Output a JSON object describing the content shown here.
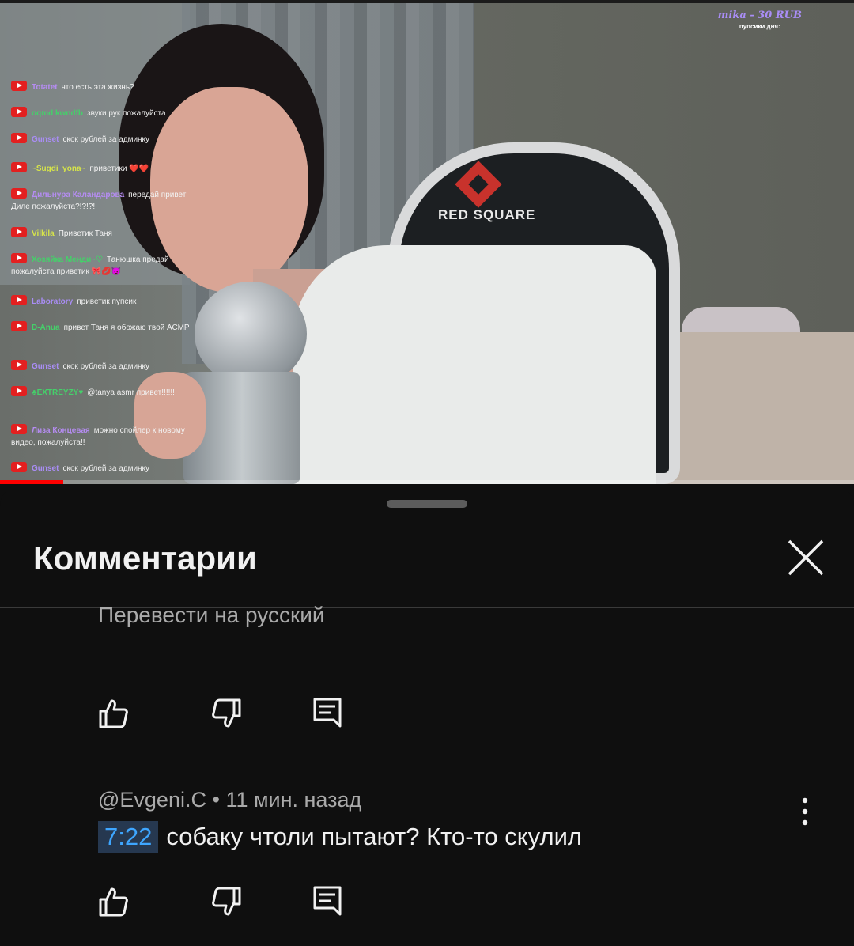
{
  "video": {
    "chair_brand": "RED SQUARE",
    "donation_line": "mika - 30 RUB",
    "donation_sub": "пупсики дня:",
    "progress": 0.074,
    "chat": [
      {
        "name": "Totatet",
        "name_color": "#b58cf2",
        "text": "что есть эта жизнь?"
      },
      {
        "name": "oqmd kwndfb",
        "name_color": "#45d06a",
        "text": "звуки рук пожалуйста"
      },
      {
        "name": "Gunset",
        "name_color": "#a98df5",
        "text": "скок рублей за админку"
      },
      {
        "name": "~Sugdi_yona~",
        "name_color": "#d6e44a",
        "text": "приветики ❤️❤️"
      },
      {
        "name": "Дильнура Каландарова",
        "name_color": "#b58cf2",
        "text": "передай привет Диле пожалуйста?!?!?!"
      },
      {
        "name": "Vilkila",
        "name_color": "#d6e44a",
        "text": "Приветик Таня"
      },
      {
        "name": "Хозяйка Менди~♡",
        "name_color": "#45d06a",
        "text": "Танюшка предай пожалуйста приветик 🎀💋😈"
      },
      {
        "name": "Laboratory",
        "name_color": "#a98df5",
        "text": "приветик пупсик"
      },
      {
        "name": "D-Anua",
        "name_color": "#45d06a",
        "text": "привет Таня я обожаю твой АСМР"
      },
      {
        "name": "Gunset",
        "name_color": "#a98df5",
        "text": "скок рублей за админку"
      },
      {
        "name": "♣EXTREYZY♥",
        "name_color": "#45d06a",
        "text": "@tanya asmr привет!!!!!!"
      },
      {
        "name": "Лиза Концевая",
        "name_color": "#b58cf2",
        "text": "можно спойлер к новому видео, пожалуйста!!"
      },
      {
        "name": "Gunset",
        "name_color": "#a98df5",
        "text": "скок рублей за админку"
      }
    ]
  },
  "sheet": {
    "title": "Комментарии",
    "close_icon": "close-icon",
    "translate_link": "Перевести на русский",
    "comment": {
      "author": "@Evgeni.C",
      "separator": " • ",
      "time": "11 мин. назад",
      "timestamp": "7:22",
      "text": "собаку чтоли пытают? Кто-то скулил"
    },
    "actions": [
      "like-icon",
      "dislike-icon",
      "reply-icon"
    ]
  }
}
